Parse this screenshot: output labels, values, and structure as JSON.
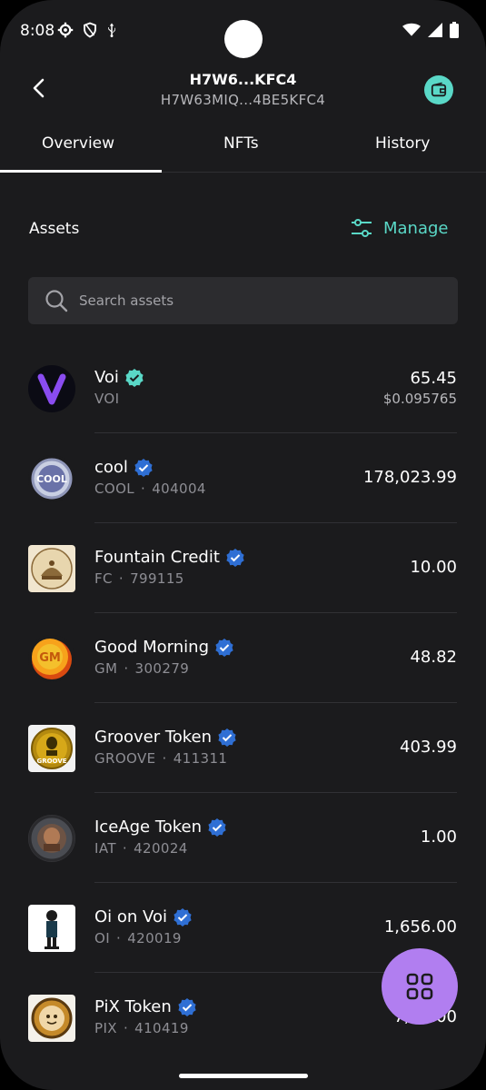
{
  "status_bar": {
    "time": "8:08",
    "icons_left": [
      "settings-icon",
      "shield-icon",
      "usb-icon"
    ],
    "icons_right": [
      "wifi-icon",
      "signal-icon",
      "battery-icon"
    ]
  },
  "header": {
    "title": "H7W6...KFC4",
    "subtitle": "H7W63MIQ...4BE5KFC4",
    "back_icon": "chevron-left-icon",
    "wallet_icon": "wallet-icon",
    "accent": "#5ad8c7"
  },
  "tabs": [
    {
      "label": "Overview",
      "active": true
    },
    {
      "label": "NFTs",
      "active": false
    },
    {
      "label": "History",
      "active": false
    }
  ],
  "assets": {
    "title": "Assets",
    "manage_label": "Manage",
    "search_placeholder": "Search assets"
  },
  "tokens": [
    {
      "name": "Voi",
      "symbol": "VOI",
      "id": "",
      "amount": "65.45",
      "fiat": "$0.095765",
      "verified_color": "#5ad8c7",
      "icon": "voi-logo"
    },
    {
      "name": "cool",
      "symbol": "COOL",
      "id": "404004",
      "amount": "178,023.99",
      "fiat": "",
      "verified_color": "#3a7bd5",
      "icon": "cool-logo"
    },
    {
      "name": "Fountain Credit",
      "symbol": "FC",
      "id": "799115",
      "amount": "10.00",
      "fiat": "",
      "verified_color": "#3a7bd5",
      "icon": "fountain-logo"
    },
    {
      "name": "Good Morning",
      "symbol": "GM",
      "id": "300279",
      "amount": "48.82",
      "fiat": "",
      "verified_color": "#3a7bd5",
      "icon": "gm-logo"
    },
    {
      "name": "Groover Token",
      "symbol": "GROOVE",
      "id": "411311",
      "amount": "403.99",
      "fiat": "",
      "verified_color": "#3a7bd5",
      "icon": "groove-logo"
    },
    {
      "name": "IceAge Token",
      "symbol": "IAT",
      "id": "420024",
      "amount": "1.00",
      "fiat": "",
      "verified_color": "#3a7bd5",
      "icon": "iceage-logo"
    },
    {
      "name": "Oi on Voi",
      "symbol": "OI",
      "id": "420019",
      "amount": "1,656.00",
      "fiat": "",
      "verified_color": "#3a7bd5",
      "icon": "oi-logo"
    },
    {
      "name": "PiX Token",
      "symbol": "PIX",
      "id": "410419",
      "amount": "7,2…00",
      "fiat": "",
      "verified_color": "#3a7bd5",
      "icon": "pix-logo"
    }
  ],
  "fab": {
    "icon": "grid-icon",
    "color": "#b17ef0"
  }
}
